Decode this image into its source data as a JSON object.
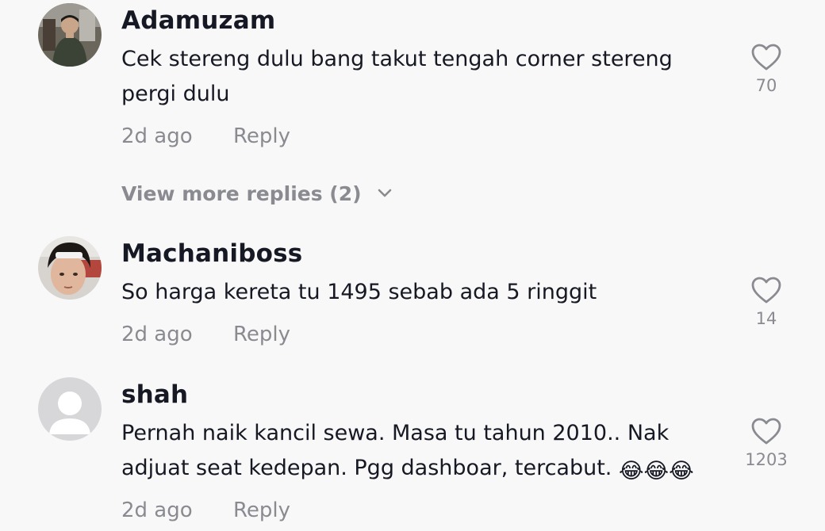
{
  "comments": [
    {
      "username": "Adamuzam",
      "text": "Cek stereng dulu bang takut tengah corner stereng pergi dulu",
      "time": "2d ago",
      "reply_label": "Reply",
      "likes": "70"
    },
    {
      "username": "Machaniboss",
      "text": "So harga kereta tu 1495 sebab ada 5 ringgit",
      "time": "2d ago",
      "reply_label": "Reply",
      "likes": "14"
    },
    {
      "username": "shah",
      "text": "Pernah naik kancil sewa. Masa tu tahun 2010.. Nak adjuat seat kedepan. Pgg dashboar, tercabut.",
      "emoji": "😂😂😂",
      "time": "2d ago",
      "reply_label": "Reply",
      "likes": "1203"
    }
  ],
  "view_more_replies": "View more replies (2)",
  "colors": {
    "background": "#f8f8f8",
    "primary_text": "#161823",
    "secondary_text": "#8a8b91"
  },
  "icons": {
    "like": "heart-outline-icon",
    "expand": "chevron-down-icon"
  }
}
